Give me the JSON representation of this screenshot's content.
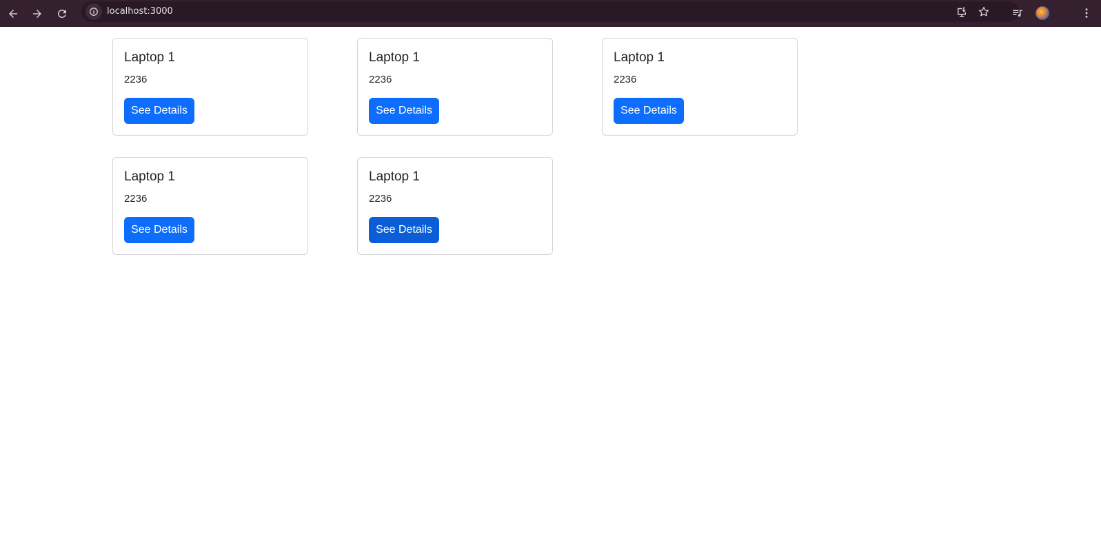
{
  "browser": {
    "url": "localhost:3000"
  },
  "products": [
    {
      "title": "Laptop 1",
      "price": "2236",
      "button_label": "See Details"
    },
    {
      "title": "Laptop 1",
      "price": "2236",
      "button_label": "See Details"
    },
    {
      "title": "Laptop 1",
      "price": "2236",
      "button_label": "See Details"
    },
    {
      "title": "Laptop 1",
      "price": "2236",
      "button_label": "See Details"
    },
    {
      "title": "Laptop 1",
      "price": "2236",
      "button_label": "See Details"
    }
  ],
  "colors": {
    "primary": "#0d6efd",
    "primary_hover": "#0b5ed7",
    "chrome_bg": "#35202f"
  }
}
